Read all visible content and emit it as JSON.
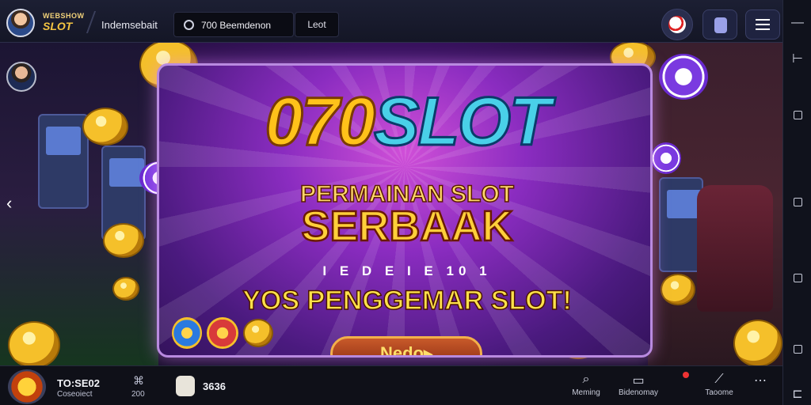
{
  "header": {
    "brand_small": "WEBSHOW",
    "brand_big": "SLOT",
    "nav_text": "Indemsebait",
    "search_text": "700 Beemdenon",
    "login_label": "Leot"
  },
  "banner": {
    "logo_part1": "070",
    "logo_part2": "SLOT",
    "subtitle_line1": "PERMAINAN SLOT",
    "subtitle_line2": "SERBAAK",
    "small_line": "I E D E I E 10 1",
    "tagline": "YOS PENGGEMAR SLOT!",
    "cta_label": "Nedo▸"
  },
  "bottom": {
    "score": "TO:SE02",
    "score_sub": "Coseoiect",
    "item1_label": "200",
    "item2_label": "3636",
    "nav": [
      {
        "label": "Meming",
        "icon": "search-icon"
      },
      {
        "label": "Bidenomay",
        "icon": "document-icon"
      },
      {
        "label": "",
        "icon": "notification-icon"
      },
      {
        "label": "Taoome",
        "icon": "pencil-icon"
      },
      {
        "label": "",
        "icon": "more-icon"
      }
    ]
  },
  "colors": {
    "gold": "#ffc21a",
    "cyan": "#49d0e8",
    "purple": "#8a2cc0",
    "bar": "#141626"
  }
}
